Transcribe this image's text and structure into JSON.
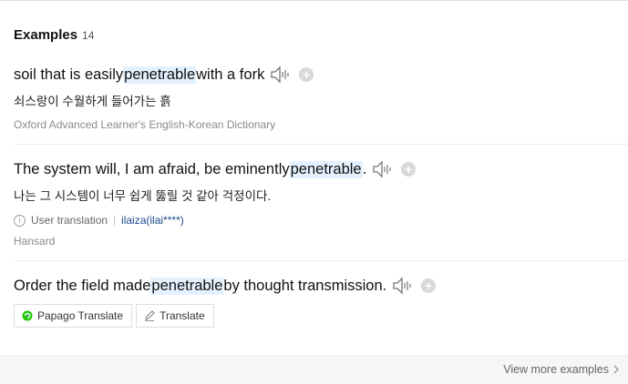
{
  "header": {
    "title": "Examples",
    "count": "14"
  },
  "examples": [
    {
      "pre": "soil that is easily ",
      "highlight": "penetrable",
      "post": " with a fork",
      "translation": "쇠스랑이 수월하게 들어가는 흙",
      "source": "Oxford Advanced Learner's English-Korean Dictionary"
    },
    {
      "pre": "The system will, I am afraid, be eminently ",
      "highlight": "penetrable",
      "post": ".",
      "translation": "나는 그 시스템이 너무 쉽게 뚫릴 것 같아 걱정이다.",
      "user_translation_label": "User translation",
      "user": "ilaiza(ilai****)",
      "source": "Hansard"
    },
    {
      "pre": "Order the field made ",
      "highlight": "penetrable",
      "post": " by thought transmission."
    }
  ],
  "buttons": {
    "papago": "Papago Translate",
    "translate": "Translate"
  },
  "footer": {
    "view_more": "View more examples"
  },
  "icons": {
    "speaker": "speaker-icon",
    "add": "plus-circle-icon",
    "info": "info-icon",
    "papago": "papago-logo-icon",
    "pencil": "pencil-icon",
    "chevron": "chevron-right-icon"
  },
  "colors": {
    "highlight": "#e3f1ff",
    "user_link": "#1a4a8c",
    "papago_green": "#1ec800"
  }
}
